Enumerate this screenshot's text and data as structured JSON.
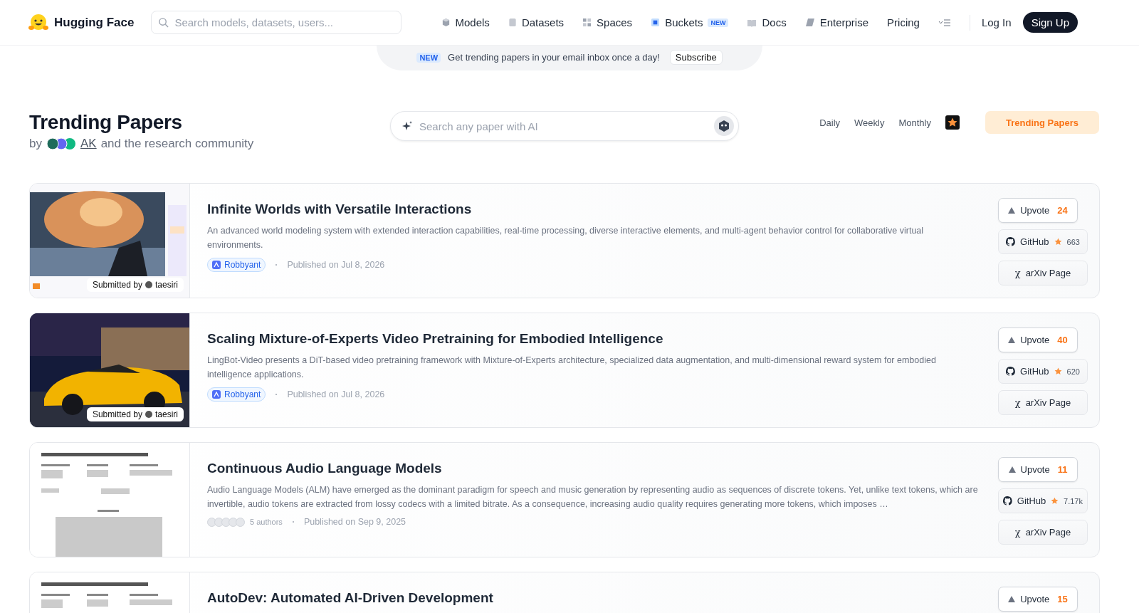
{
  "nav": {
    "brand": "Hugging Face",
    "search_placeholder": "Search models, datasets, users...",
    "items": [
      {
        "label": "Models"
      },
      {
        "label": "Datasets"
      },
      {
        "label": "Spaces"
      },
      {
        "label": "Buckets",
        "badge": "NEW"
      },
      {
        "label": "Docs"
      },
      {
        "label": "Enterprise"
      },
      {
        "label": "Pricing"
      }
    ],
    "login": "Log In",
    "signup": "Sign Up"
  },
  "banner": {
    "badge": "NEW",
    "text": "Get trending papers in your email inbox once a day!",
    "button": "Subscribe"
  },
  "heading": {
    "title": "Trending Papers",
    "by": "by",
    "author": "AK",
    "rest": "and the research community",
    "search_placeholder": "Search any paper with AI",
    "periods": [
      {
        "label": "Daily",
        "selected": false
      },
      {
        "label": "Weekly",
        "selected": false
      },
      {
        "label": "Monthly",
        "selected": false
      }
    ],
    "trending_button": "Trending Papers"
  },
  "papers": [
    {
      "submitted_label": "Submitted by",
      "submitter": "taesiri",
      "title": "Infinite Worlds with Versatile Interactions",
      "summary": "An advanced world modeling system with extended interaction capabilities, real-time processing, diverse interactive elements, and multi-agent behavior control for collaborative virtual environments.",
      "org": "Robbyant",
      "published": "Published on Jul 8, 2026",
      "upvote": "Upvote",
      "votes": "24",
      "github": "GitHub",
      "stars": "663",
      "arxiv_symbol": "χ",
      "arxiv": "arXiv Page"
    },
    {
      "submitted_label": "Submitted by",
      "submitter": "taesiri",
      "title": "Scaling Mixture-of-Experts Video Pretraining for Embodied Intelligence",
      "summary": "LingBot-Video presents a DiT-based video pretraining framework with Mixture-of-Experts architecture, specialized data augmentation, and multi-dimensional reward system for embodied intelligence applications.",
      "org": "Robbyant",
      "published": "Published on Jul 8, 2026",
      "upvote": "Upvote",
      "votes": "40",
      "github": "GitHub",
      "stars": "620",
      "arxiv_symbol": "χ",
      "arxiv": "arXiv Page"
    },
    {
      "title": "Continuous Audio Language Models",
      "summary": "Audio Language Models (ALM) have emerged as the dominant paradigm for speech and music generation by representing audio as sequences of discrete tokens. Yet, unlike text tokens, which are invertible, audio tokens are extracted from lossy codecs with a limited bitrate. As a consequence, increasing audio quality requires generating more tokens, which imposes …",
      "authors": "5 authors",
      "published": "Published on Sep 9, 2025",
      "upvote": "Upvote",
      "votes": "11",
      "github": "GitHub",
      "stars": "7.17k",
      "arxiv_symbol": "χ",
      "arxiv": "arXiv Page"
    },
    {
      "title": "AutoDev: Automated AI-Driven Development",
      "upvote": "Upvote",
      "votes": "15"
    }
  ]
}
